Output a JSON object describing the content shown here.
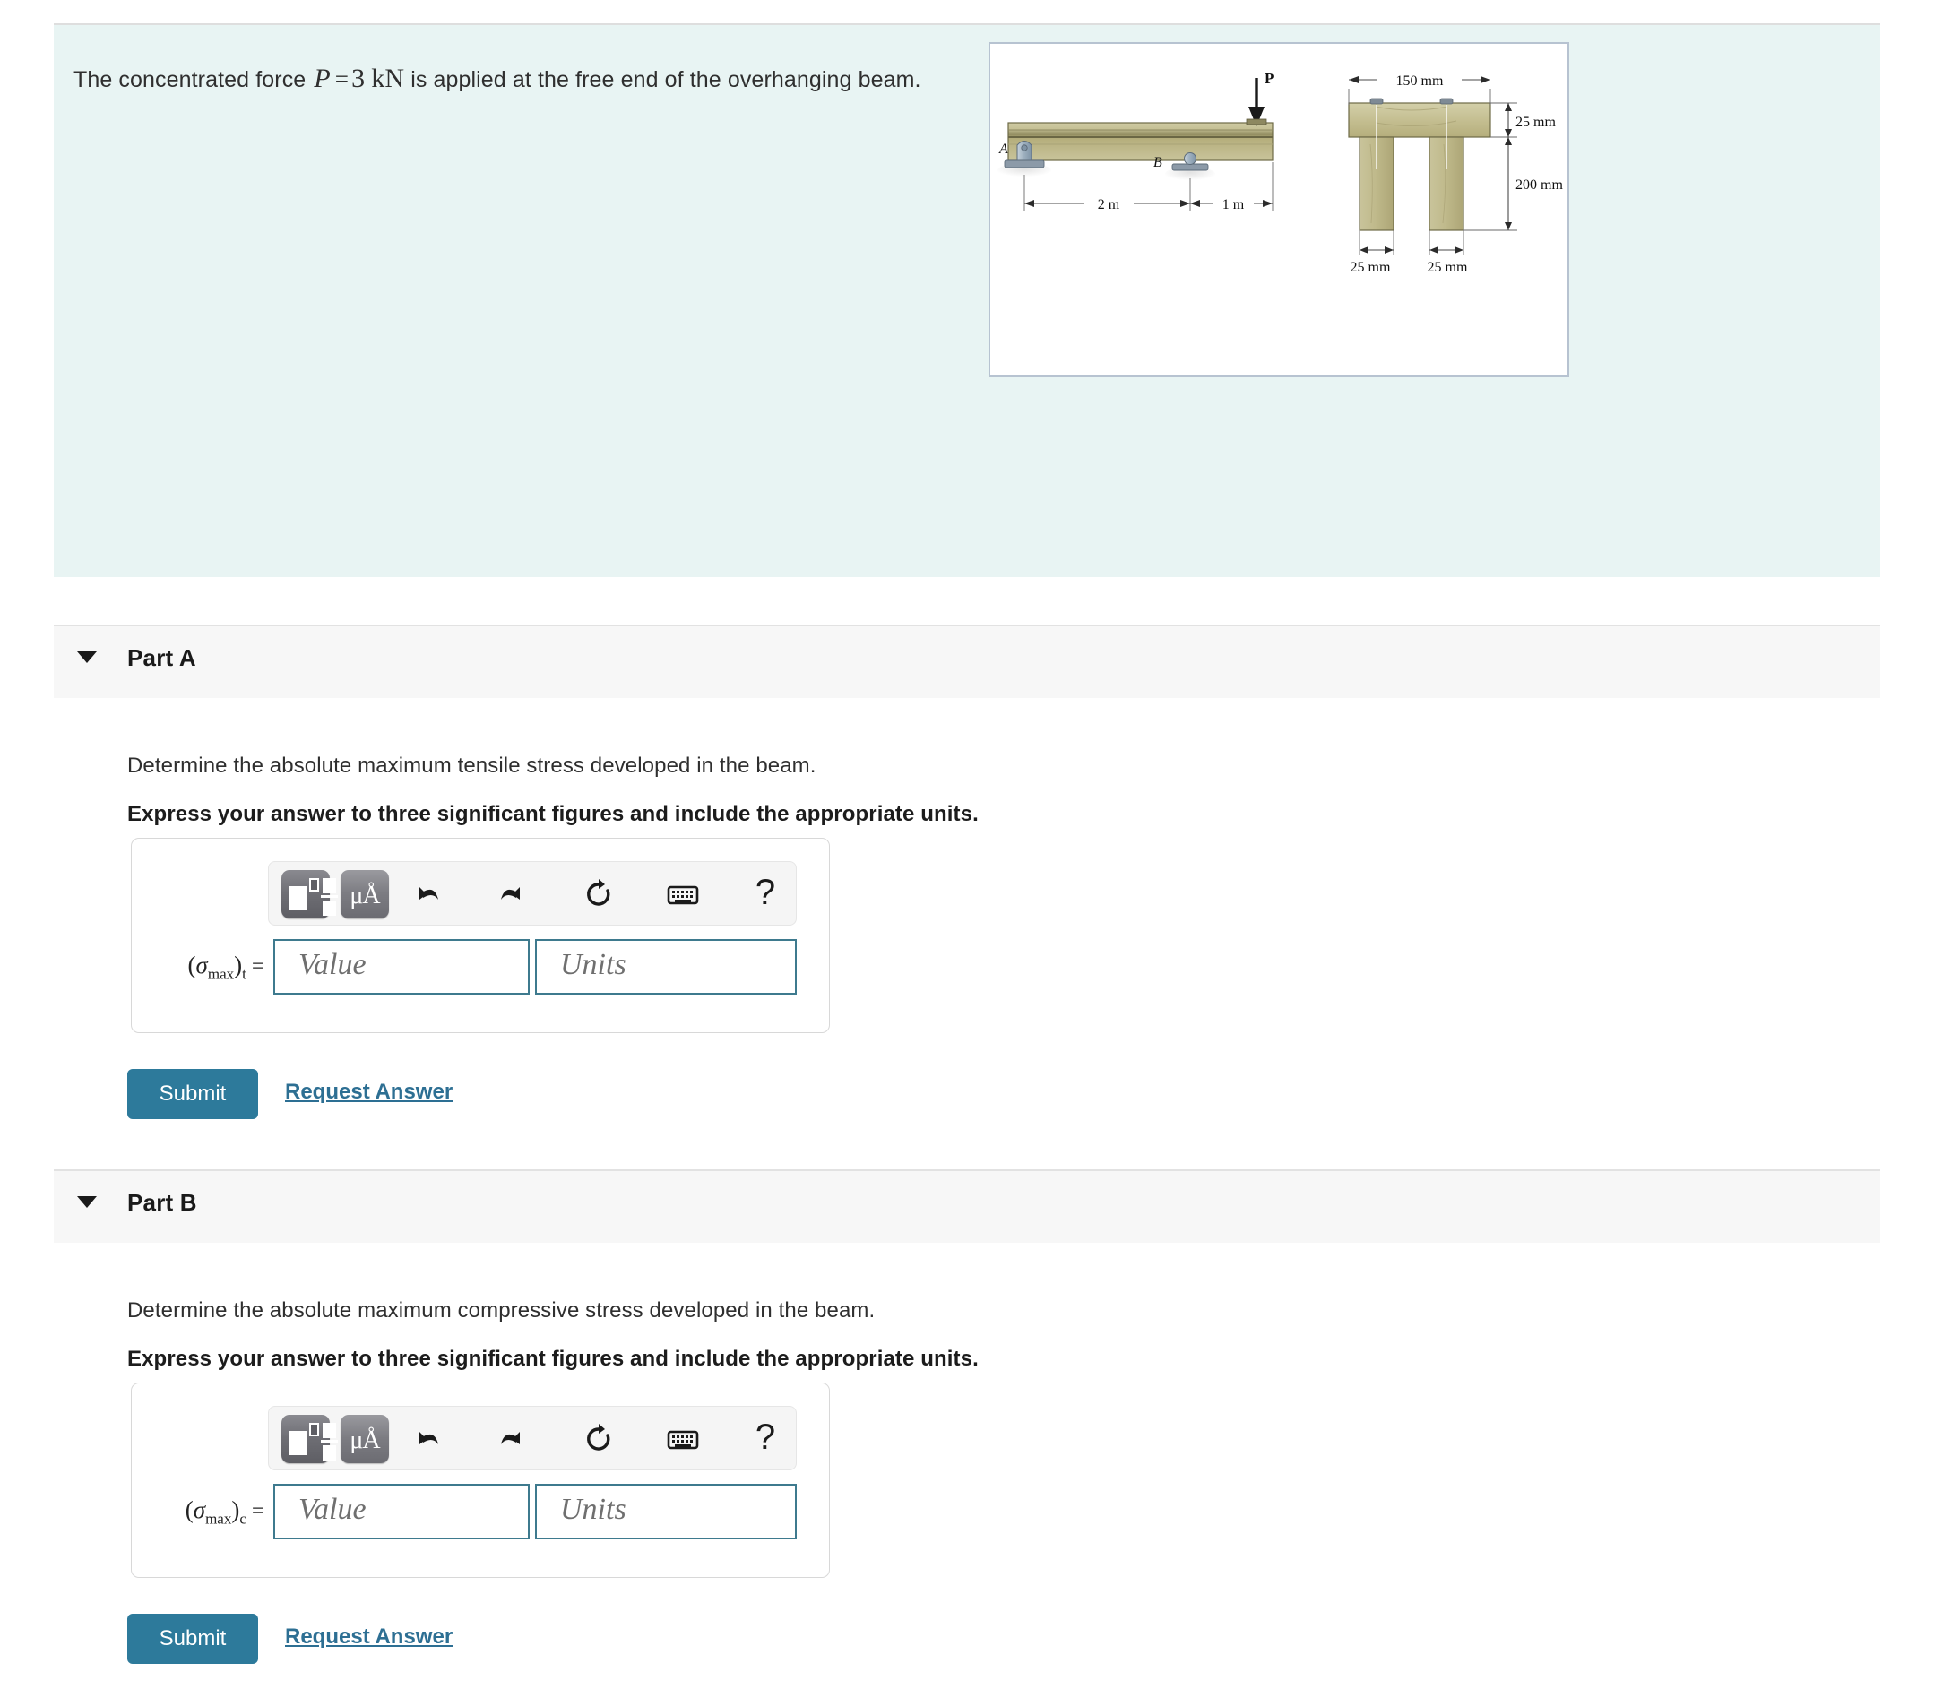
{
  "problem": {
    "text_before": "The concentrated force",
    "symbol": "P",
    "equals": "=",
    "magnitude": "3",
    "unit": "kN",
    "text_after": "is applied at the free end of the overhanging beam."
  },
  "figure": {
    "label_P": "P",
    "label_A": "A",
    "label_B": "B",
    "span_AB": "2 m",
    "span_overhang": "1 m",
    "flange_width": "150 mm",
    "flange_thickness": "25 mm",
    "web_height": "200 mm",
    "leg1_width": "25 mm",
    "leg2_width": "25 mm",
    "wood_light": "#cbc79a",
    "wood_mid": "#b9b382",
    "wood_dark": "#8f8a5e",
    "support_blue": "#9fb4c4"
  },
  "parts": [
    {
      "id": "part-a",
      "title": "Part A",
      "caret": "triangle-down-icon",
      "question": "Determine the absolute maximum tensile stress developed in the beam.",
      "instruction": "Express your answer to three significant figures and include the appropriate units.",
      "answer": {
        "label_sigma": "σ",
        "label_sub": "max",
        "label_qualifier": "t",
        "label_equals": "=",
        "value_placeholder": "Value",
        "units_placeholder": "Units",
        "value_current": "",
        "units_current": ""
      },
      "toolbar": {
        "template_button": "math-template-icon",
        "units_button": "μÅ",
        "undo": "undo-icon",
        "redo": "redo-icon",
        "reset": "reset-icon",
        "keyboard": "keyboard-icon",
        "help": "?"
      },
      "submit_label": "Submit",
      "request_label": "Request Answer"
    },
    {
      "id": "part-b",
      "title": "Part B",
      "caret": "triangle-down-icon",
      "question": "Determine the absolute maximum compressive stress developed in the beam.",
      "instruction": "Express your answer to three significant figures and include the appropriate units.",
      "answer": {
        "label_sigma": "σ",
        "label_sub": "max",
        "label_qualifier": "c",
        "label_equals": "=",
        "value_placeholder": "Value",
        "units_placeholder": "Units",
        "value_current": "",
        "units_current": ""
      },
      "toolbar": {
        "template_button": "math-template-icon",
        "units_button": "μÅ",
        "undo": "undo-icon",
        "redo": "redo-icon",
        "reset": "reset-icon",
        "keyboard": "keyboard-icon",
        "help": "?"
      },
      "submit_label": "Submit",
      "request_label": "Request Answer"
    }
  ],
  "colors": {
    "problem_bg": "#e8f4f3",
    "band_bg": "#f7f7f7",
    "accent": "#2d7a9b",
    "field_border": "#3e7a8e",
    "figure_border": "#b7c3d1"
  }
}
